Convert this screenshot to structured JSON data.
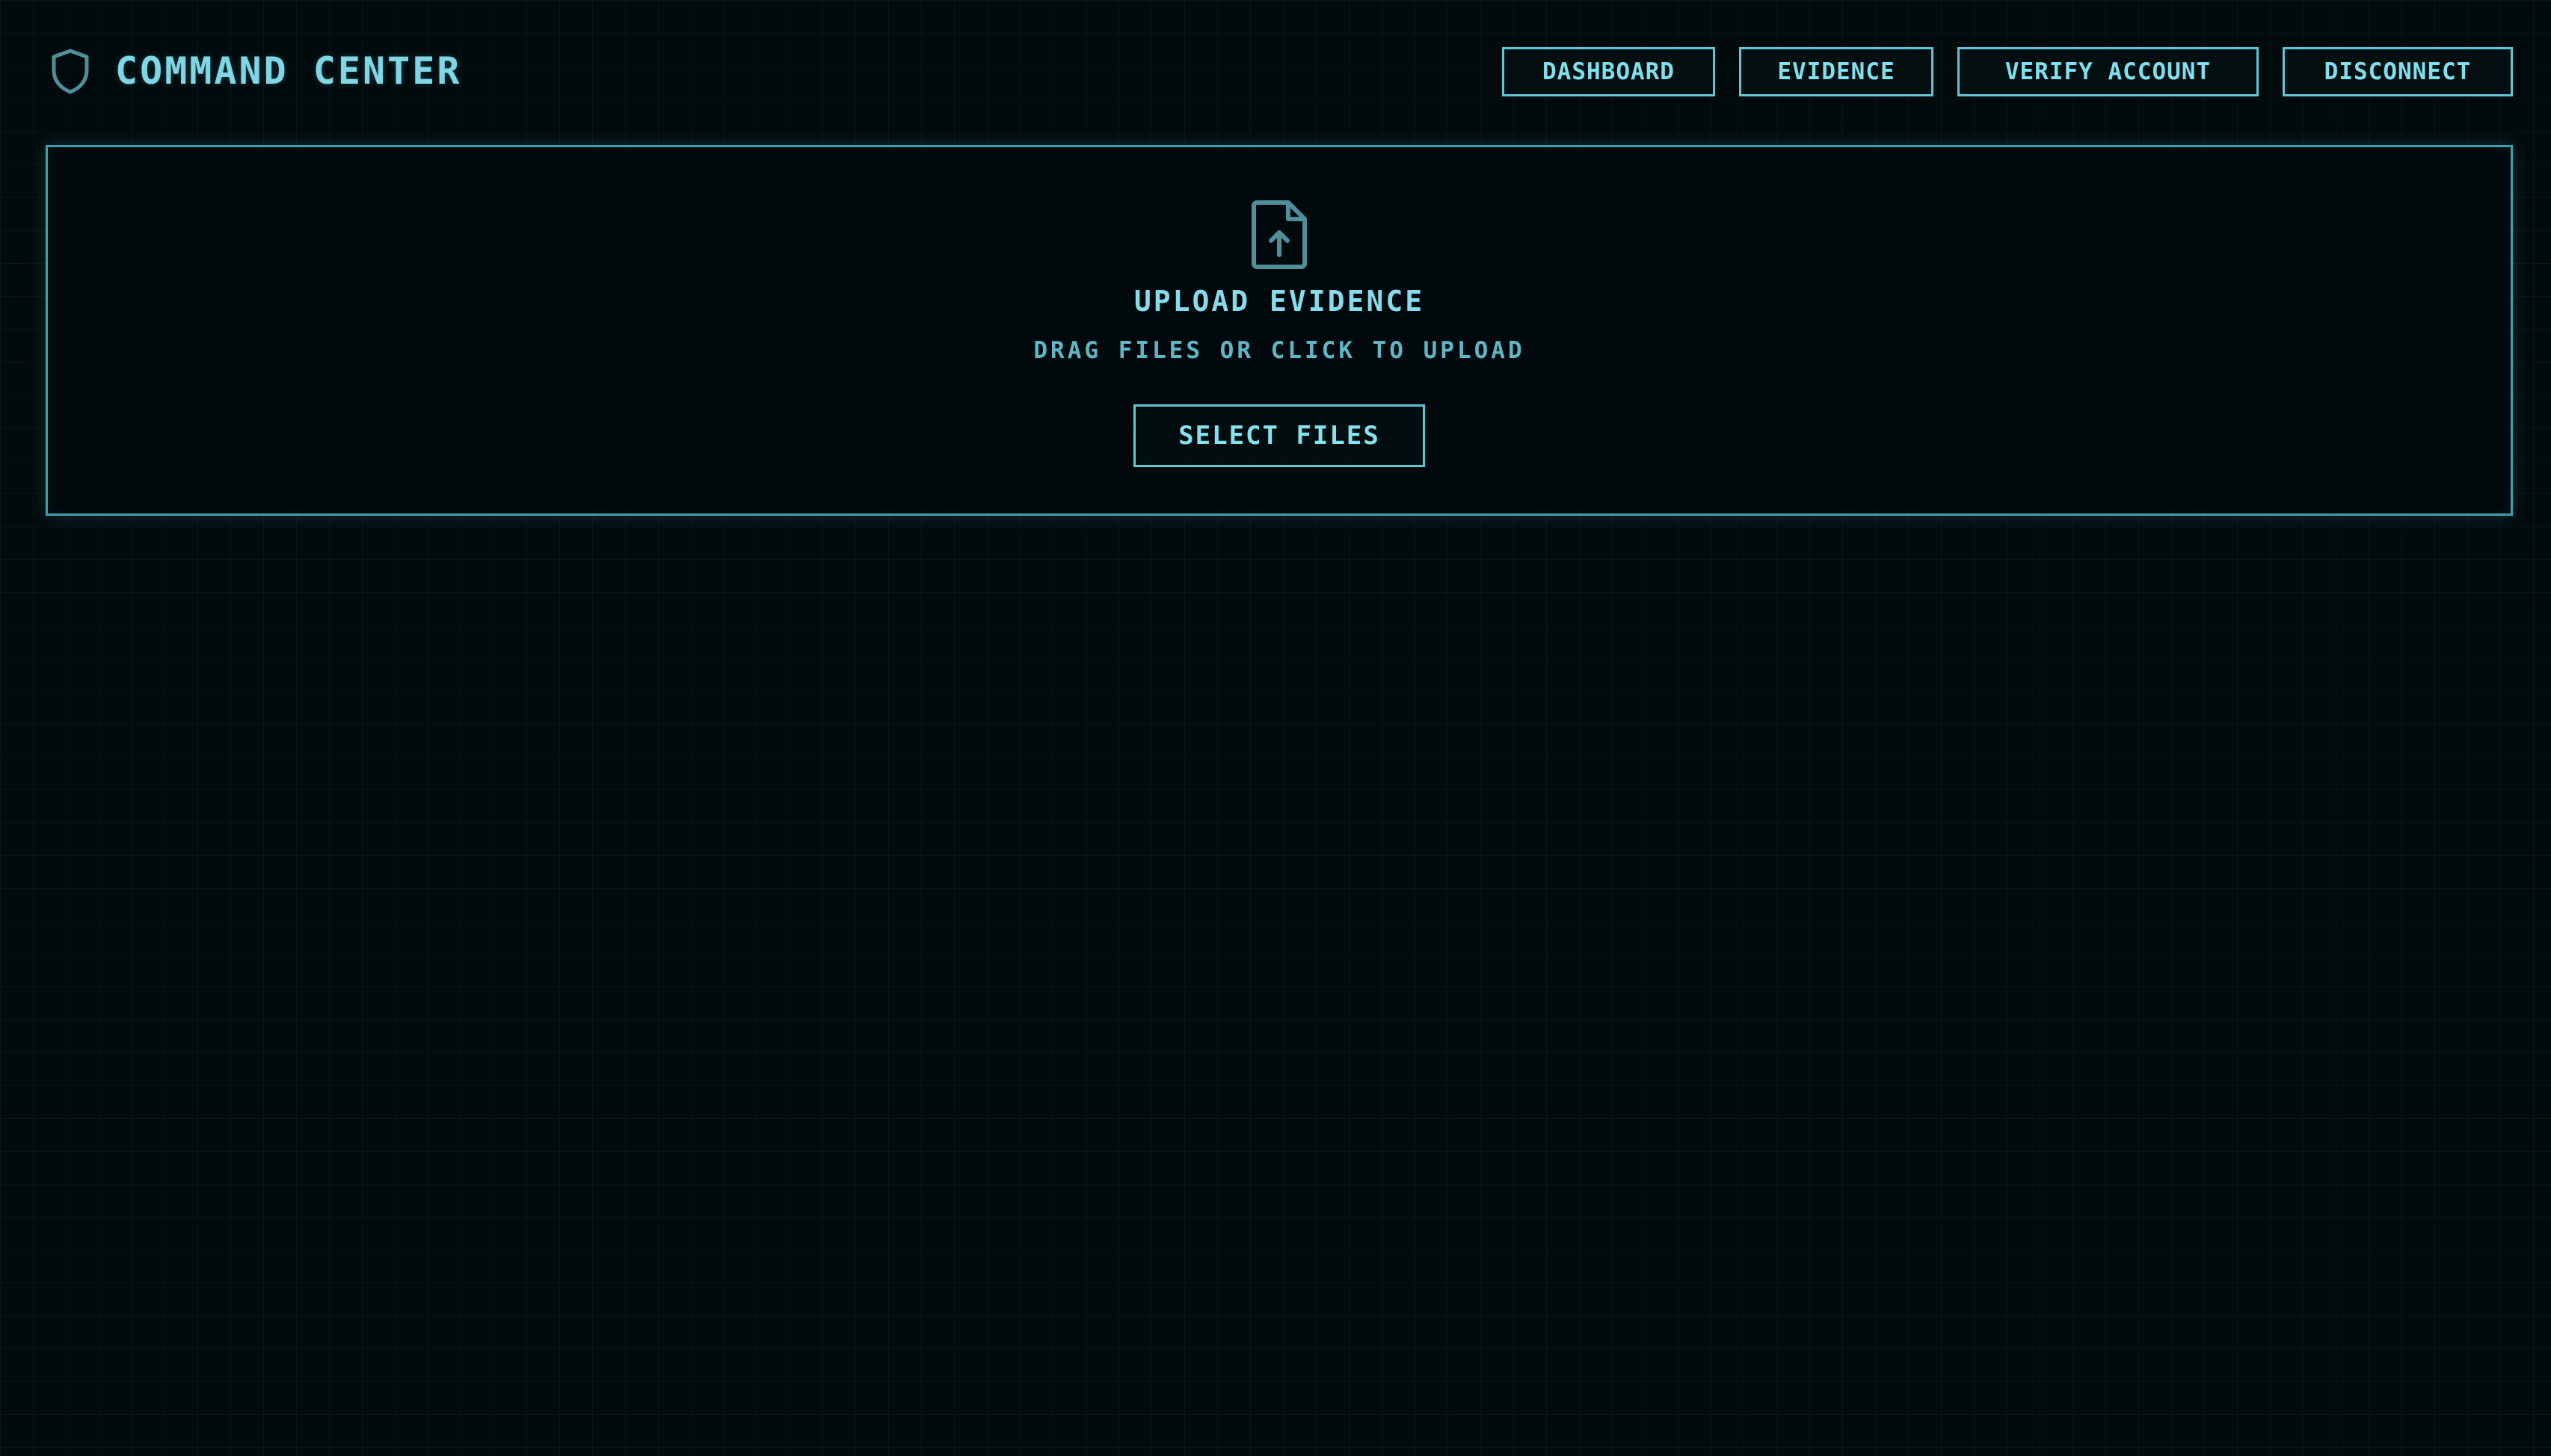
{
  "header": {
    "title": "COMMAND CENTER",
    "logo_icon": "shield-icon",
    "nav": [
      {
        "label": "DASHBOARD"
      },
      {
        "label": "EVIDENCE"
      },
      {
        "label": "VERIFY ACCOUNT"
      },
      {
        "label": "DISCONNECT"
      }
    ]
  },
  "upload": {
    "icon": "file-upload-icon",
    "title": "UPLOAD EVIDENCE",
    "subtitle": "DRAG FILES OR CLICK TO UPLOAD",
    "button_label": "SELECT FILES"
  },
  "colors": {
    "background": "#030a0c",
    "accent": "#5fc6d6",
    "text": "#7fd7e6",
    "icon": "#4f8f9c"
  }
}
